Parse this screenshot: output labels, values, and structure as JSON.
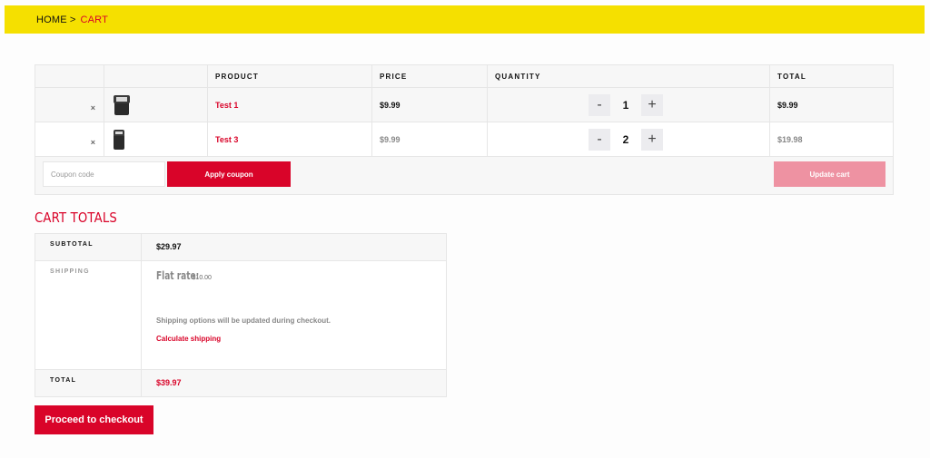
{
  "breadcrumb": {
    "home": "HOME",
    "separator": ">",
    "current": "CART"
  },
  "cart": {
    "headers": {
      "product": "PRODUCT",
      "price": "PRICE",
      "quantity": "QUANTITY",
      "total": "TOTAL"
    },
    "items": [
      {
        "remove": "×",
        "name": "Test 1",
        "price": "$9.99",
        "minus": "-",
        "quantity": "1",
        "plus": "+",
        "total": "$9.99"
      },
      {
        "remove": "×",
        "name": "Test 3",
        "price": "$9.99",
        "minus": "-",
        "quantity": "2",
        "plus": "+",
        "total": "$19.98"
      }
    ],
    "coupon_placeholder": "Coupon code",
    "apply_label": "Apply coupon",
    "update_label": "Update cart"
  },
  "totals": {
    "title": "CART TOTALS",
    "subtotal_label": "SUBTOTAL",
    "subtotal_value": "$29.97",
    "shipping_label": "SHIPPING",
    "flat_rate_label": "Flat rate:",
    "flat_rate_value": "$10.00",
    "shipping_note": "Shipping options will be updated during checkout.",
    "calculate_label": "Calculate shipping",
    "total_label": "TOTAL",
    "total_value": "$39.97"
  },
  "checkout_label": "Proceed to checkout",
  "colors": {
    "accent": "#d90429",
    "banner": "#f5e000",
    "update_disabled": "#ee92a2"
  }
}
